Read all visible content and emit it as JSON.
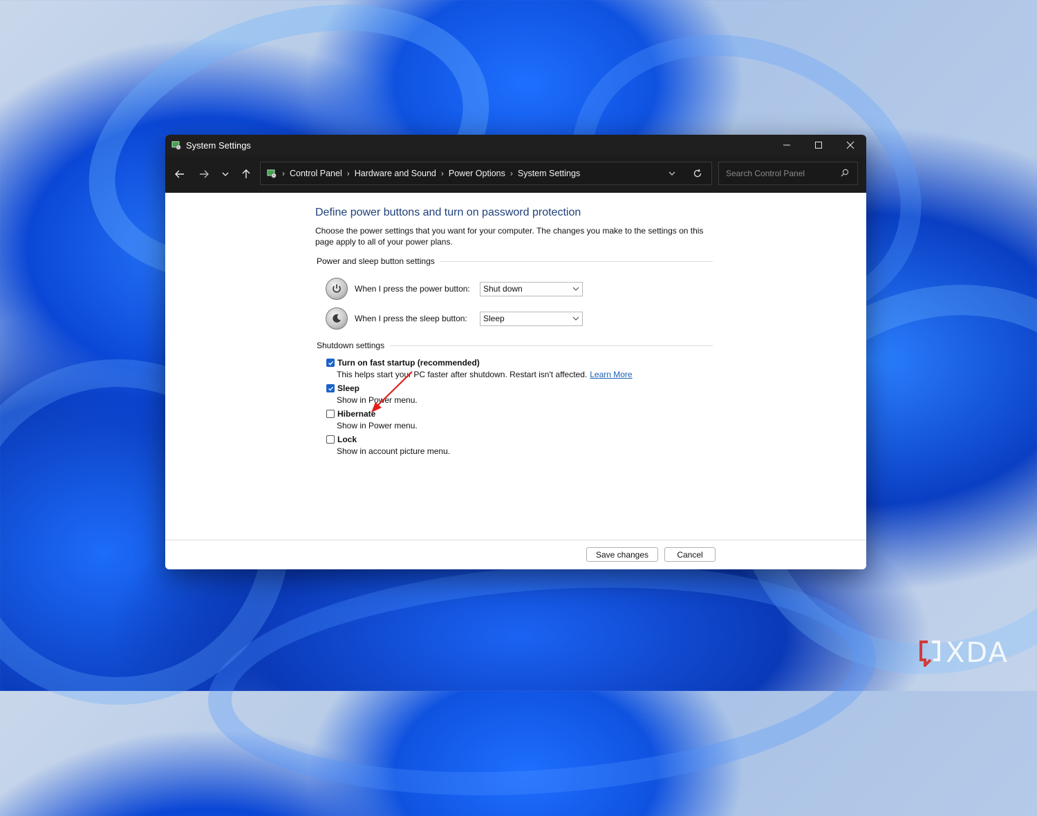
{
  "window": {
    "title": "System Settings"
  },
  "nav": {
    "back_icon": "arrow-left-icon",
    "forward_icon": "arrow-right-icon",
    "recent_icon": "chevron-down-icon",
    "up_icon": "arrow-up-icon"
  },
  "breadcrumb": [
    "Control Panel",
    "Hardware and Sound",
    "Power Options",
    "System Settings"
  ],
  "search": {
    "placeholder": "Search Control Panel"
  },
  "page": {
    "title": "Define power buttons and turn on password protection",
    "description": "Choose the power settings that you want for your computer. The changes you make to the settings on this page apply to all of your power plans."
  },
  "power_sleep": {
    "heading": "Power and sleep button settings",
    "power_button_label": "When I press the power button:",
    "power_button_value": "Shut down",
    "sleep_button_label": "When I press the sleep button:",
    "sleep_button_value": "Sleep"
  },
  "shutdown": {
    "heading": "Shutdown settings",
    "items": [
      {
        "label": "Turn on fast startup (recommended)",
        "desc": "This helps start your PC faster after shutdown. Restart isn't affected.",
        "link": "Learn More",
        "checked": true
      },
      {
        "label": "Sleep",
        "desc": "Show in Power menu.",
        "checked": true
      },
      {
        "label": "Hibernate",
        "desc": "Show in Power menu.",
        "checked": false
      },
      {
        "label": "Lock",
        "desc": "Show in account picture menu.",
        "checked": false
      }
    ]
  },
  "footer": {
    "save_label": "Save changes",
    "cancel_label": "Cancel"
  },
  "colors": {
    "accent": "#1a62c9",
    "title_blue": "#1e3f7a",
    "link": "#1a5fb4",
    "annotation": "#e0201a"
  },
  "watermark": "XDA"
}
